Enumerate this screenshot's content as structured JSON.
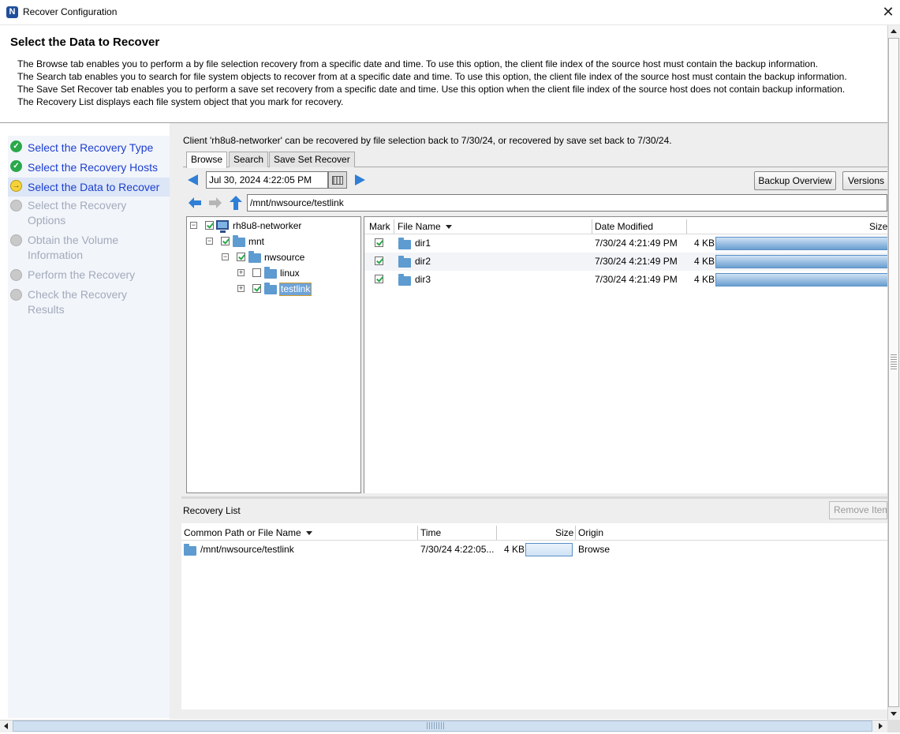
{
  "window": {
    "title": "Recover Configuration",
    "app_icon_letter": "N",
    "close_glyph": "✕"
  },
  "header": {
    "title": "Select the Data to Recover",
    "description_lines": [
      "The Browse tab enables you to perform a by file selection recovery from a specific date and time. To use this option, the client file index of the source host must contain the backup information.",
      "The Search tab enables you to search for file system objects to recover from at a specific date and time. To use this option, the client file index of the source host must contain the backup information.",
      "The Save Set Recover tab enables you to perform a save set recovery from a specific date and time.  Use this option when the client file index of the source host does not contain backup information.",
      "The Recovery List displays each file system object that you mark for recovery."
    ]
  },
  "steps": [
    {
      "line1": "Select the Recovery Type",
      "line2": "",
      "state": "done"
    },
    {
      "line1": "Select the Recovery Hosts",
      "line2": "",
      "state": "done"
    },
    {
      "line1": "Select the Data to Recover",
      "line2": "",
      "state": "current"
    },
    {
      "line1": "Select the Recovery",
      "line2": "Options",
      "state": "pending"
    },
    {
      "line1": "Obtain the Volume",
      "line2": "Information",
      "state": "pending"
    },
    {
      "line1": "Perform the Recovery",
      "line2": "",
      "state": "pending"
    },
    {
      "line1": "Check the Recovery",
      "line2": "Results",
      "state": "pending"
    }
  ],
  "client_info": "Client 'rh8u8-networker' can be recovered by file selection back to 7/30/24, or recovered by save set back to 7/30/24.",
  "tabs": [
    {
      "label": "Browse",
      "active": true
    },
    {
      "label": "Search",
      "active": false
    },
    {
      "label": "Save Set Recover",
      "active": false
    }
  ],
  "toolbar": {
    "date_value": "Jul 30, 2024 4:22:05 PM",
    "backup_overview_label": "Backup Overview",
    "versions_label": "Versions",
    "path_value": "/mnt/nwsource/testlink"
  },
  "tree": [
    {
      "label": "rh8u8-networker",
      "type": "computer",
      "checked": true,
      "expander": "−"
    },
    {
      "label": "mnt",
      "type": "folder",
      "checked": true,
      "expander": "−"
    },
    {
      "label": "nwsource",
      "type": "folder",
      "checked": true,
      "expander": "−"
    },
    {
      "label": "linux",
      "type": "folder",
      "checked": false,
      "expander": "+"
    },
    {
      "label": "testlink",
      "type": "folder",
      "checked": true,
      "expander": "+",
      "selected": true
    }
  ],
  "file_table": {
    "columns": {
      "mark": "Mark",
      "name": "File Name",
      "date": "Date Modified",
      "size": "Size"
    },
    "rows": [
      {
        "name": "dir1",
        "date": "7/30/24 4:21:49 PM",
        "size": "4 KB",
        "checked": true
      },
      {
        "name": "dir2",
        "date": "7/30/24 4:21:49 PM",
        "size": "4 KB",
        "checked": true
      },
      {
        "name": "dir3",
        "date": "7/30/24 4:21:49 PM",
        "size": "4 KB",
        "checked": true
      }
    ]
  },
  "recovery_list": {
    "title": "Recovery List",
    "remove_label": "Remove Item",
    "columns": {
      "path": "Common Path or File Name",
      "time": "Time",
      "size": "Size",
      "origin": "Origin"
    },
    "rows": [
      {
        "path": "/mnt/nwsource/testlink",
        "time": "7/30/24 4:22:05...",
        "size": "4 KB",
        "origin": "Browse"
      }
    ]
  },
  "colors": {
    "accent": "#1d3ecf",
    "folder": "#5d9bd0",
    "check": "#2aa84a",
    "nav_arrow": "#2f7fd6"
  }
}
